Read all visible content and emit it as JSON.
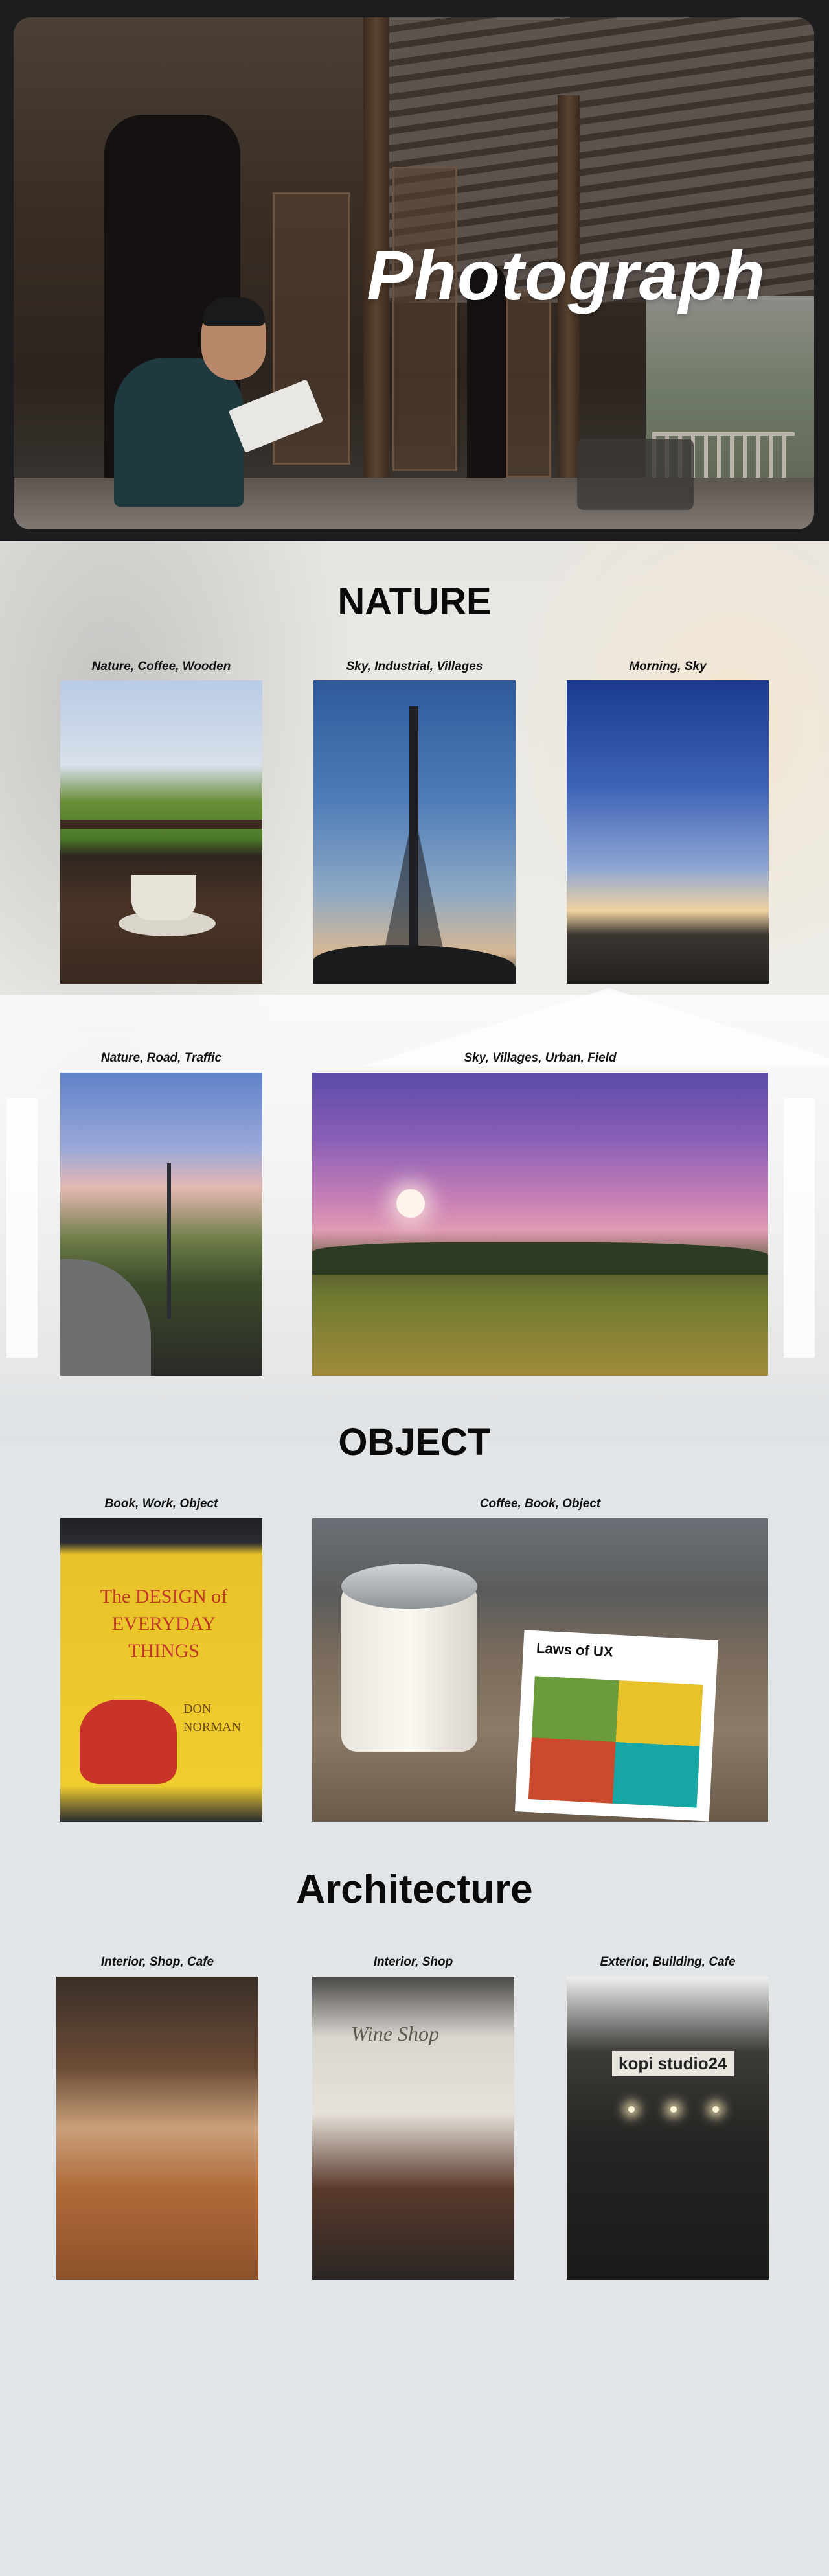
{
  "hero": {
    "title": "Photograph"
  },
  "sections": {
    "nature": {
      "title": "NATURE",
      "photos": [
        {
          "caption": "Nature, Coffee, Wooden"
        },
        {
          "caption": "Sky, Industrial, Villages"
        },
        {
          "caption": "Morning, Sky"
        },
        {
          "caption": "Nature, Road, Traffic"
        },
        {
          "caption": "Sky, Villages, Urban, Field"
        }
      ]
    },
    "object": {
      "title": "OBJECT",
      "photos": [
        {
          "caption": "Book, Work, Object",
          "book_title": "The DESIGN of EVERYDAY THINGS",
          "book_author": "DON NORMAN"
        },
        {
          "caption": "Coffee, Book, Object",
          "book_title": "Laws of UX"
        }
      ]
    },
    "architecture": {
      "title": "Architecture",
      "photos": [
        {
          "caption": "Interior, Shop, Cafe"
        },
        {
          "caption": "Interior, Shop",
          "sign": "Wine Shop"
        },
        {
          "caption": "Exterior, Building, Cafe",
          "sign": "kopi studio24"
        }
      ]
    }
  }
}
